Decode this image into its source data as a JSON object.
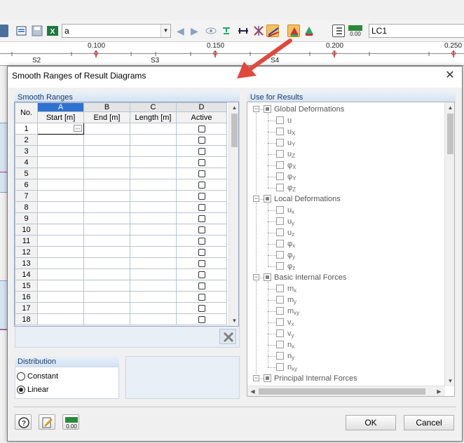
{
  "toolbar": {
    "combo_value": "a",
    "lc_value": "LC1",
    "value_badge": "0.00"
  },
  "ruler": {
    "ticks": [
      "0.100",
      "0.150",
      "0.200",
      "0.250"
    ],
    "sections": [
      "S2",
      "S3",
      "S4"
    ]
  },
  "dialog": {
    "title": "Smooth Ranges of Result Diagrams",
    "smooth_ranges": {
      "heading": "Smooth Ranges",
      "col_letters": [
        "A",
        "B",
        "C",
        "D"
      ],
      "no_label": "No.",
      "col_labels": [
        "Start [m]",
        "End [m]",
        "Length [m]",
        "Active"
      ],
      "rows": [
        "1",
        "2",
        "3",
        "4",
        "5",
        "6",
        "7",
        "8",
        "9",
        "10",
        "11",
        "12",
        "13",
        "14",
        "15",
        "16",
        "17",
        "18"
      ]
    },
    "use_for_results": {
      "heading": "Use for Results",
      "groups": [
        {
          "label": "Global Deformations",
          "items": [
            {
              "main": "u",
              "sub": ""
            },
            {
              "main": "u",
              "sub": "X"
            },
            {
              "main": "u",
              "sub": "Y"
            },
            {
              "main": "u",
              "sub": "Z"
            },
            {
              "main": "φ",
              "sub": "X"
            },
            {
              "main": "φ",
              "sub": "Y"
            },
            {
              "main": "φ",
              "sub": "Z"
            }
          ]
        },
        {
          "label": "Local Deformations",
          "items": [
            {
              "main": "u",
              "sub": "x"
            },
            {
              "main": "u",
              "sub": "y"
            },
            {
              "main": "u",
              "sub": "z"
            },
            {
              "main": "φ",
              "sub": "x"
            },
            {
              "main": "φ",
              "sub": "y"
            },
            {
              "main": "φ",
              "sub": "z"
            }
          ]
        },
        {
          "label": "Basic Internal Forces",
          "items": [
            {
              "main": "m",
              "sub": "x"
            },
            {
              "main": "m",
              "sub": "y"
            },
            {
              "main": "m",
              "sub": "xy"
            },
            {
              "main": "v",
              "sub": "x"
            },
            {
              "main": "v",
              "sub": "y"
            },
            {
              "main": "n",
              "sub": "x"
            },
            {
              "main": "n",
              "sub": "y"
            },
            {
              "main": "n",
              "sub": "xy"
            }
          ]
        },
        {
          "label": "Principal Internal Forces",
          "items": []
        }
      ]
    },
    "distribution": {
      "heading": "Distribution",
      "options": [
        "Constant",
        "Linear"
      ],
      "selected": "Linear"
    },
    "footer": {
      "ok_label": "OK",
      "cancel_label": "Cancel",
      "value_badge": "0.00"
    }
  },
  "colors": {
    "accent_blue": "#2e73d0",
    "arrow_red": "#e0483e",
    "group_header": "#d3e1f2"
  }
}
